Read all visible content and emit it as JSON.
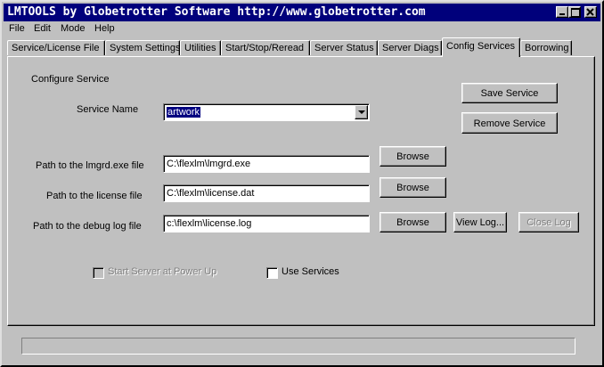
{
  "window": {
    "title": "LMTOOLS by Globetrotter Software http://www.globetrotter.com",
    "controls": [
      "minimize-icon",
      "maximize-icon",
      "close-icon"
    ]
  },
  "menu": {
    "file": "File",
    "edit": "Edit",
    "mode": "Mode",
    "help": "Help"
  },
  "tabs": [
    "Service/License File",
    "System Settings",
    "Utilities",
    "Start/Stop/Reread",
    "Server Status",
    "Server Diags",
    "Config Services",
    "Borrowing"
  ],
  "active_tab": "Config Services",
  "config": {
    "section_label": "Configure Service",
    "service_name_label": "Service Name",
    "service_name_value": "artwork",
    "lmgrd_label": "Path to the lmgrd.exe file",
    "lmgrd_value": "C:\\flexlm\\lmgrd.exe",
    "license_label": "Path to the license file",
    "license_value": "C:\\flexlm\\license.dat",
    "debug_label": "Path to the debug log file",
    "debug_value": "c:\\flexlm\\license.log",
    "save_service": "Save Service",
    "remove_service": "Remove Service",
    "browse": "Browse",
    "view_log": "View Log...",
    "close_log": "Close Log",
    "start_at_powerup": "Start Server at Power Up",
    "use_services": "Use Services"
  },
  "status_text": ""
}
